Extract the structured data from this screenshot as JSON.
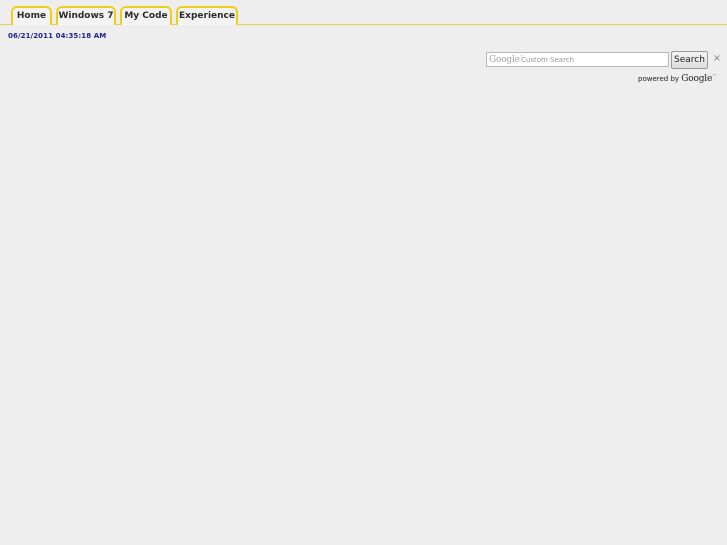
{
  "nav": {
    "tabs": [
      {
        "label": "Home"
      },
      {
        "label": "Windows 7"
      },
      {
        "label": "My Code"
      },
      {
        "label": "Experience"
      }
    ]
  },
  "timestamp": "06/21/2011 04:35:18 AM",
  "search": {
    "watermark": "Google",
    "watermark_tm": "™",
    "placeholder": "Custom Search",
    "value": "",
    "button_label": "Search",
    "clear_label": "×",
    "powered_by_prefix": "powered by",
    "powered_by_brand": "Google",
    "powered_by_tm": "™"
  },
  "colors": {
    "tab_border": "#f0cf1a",
    "timestamp_text": "#1e1e8c",
    "background": "#efeeee"
  }
}
